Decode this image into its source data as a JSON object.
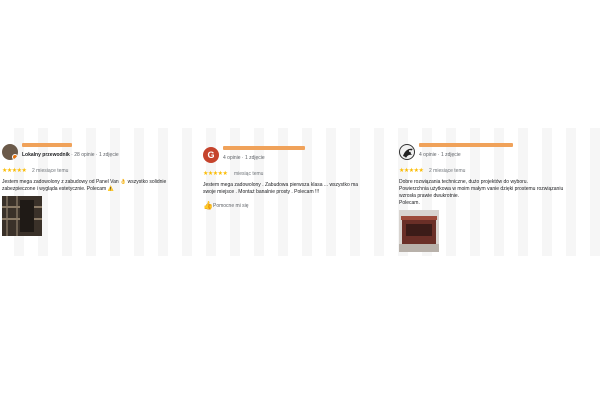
{
  "reviews": [
    {
      "avatar": "user-photo",
      "meta_strong": "Lokalny przewodnik",
      "meta_rest": " · 28 opinie · 1 zdjęcie",
      "stars": "★★★★★",
      "when": "2 miesiące temu",
      "lines": [
        "Jestem mega zadowolony z zabudowy od Panel Van 👌 wszystko solidnie",
        "zabezpieczone i wygląda estetycznie. Polecam ⚠️"
      ],
      "photo": "van-interior-photo"
    },
    {
      "avatar_letter": "G",
      "meta_strong": "",
      "meta_rest": "4 opinie · 1 zdjęcie",
      "stars": "★★★★★",
      "when": "miesiąc temu",
      "lines": [
        "Jestem mega zadowolony . Zabudowa pierwsza klasa ... wszystko ma",
        "swoje miejsce . Montaż banalnie prosty . Polecam !!!"
      ],
      "helpful": "Pomocne mi się"
    },
    {
      "avatar": "user-photo",
      "meta_strong": "",
      "meta_rest": "4 opinie · 1 zdjęcie",
      "stars": "★★★★★",
      "when": "2 miesiące temu",
      "lines": [
        "Dobre rozwiązania techniczne, dużo projektów do wyboru.",
        "Powierzchnia użytkowa w moim małym vanie dzięki prostemu rozwiązaniu",
        "wzrosła prawie dwukrotnie.",
        "Polecam."
      ],
      "photo": "cargo-box-photo"
    }
  ],
  "colors": {
    "name_bar": "#f0a25a",
    "stars": "#fbbc04",
    "avatar_g": "#c5432c"
  }
}
